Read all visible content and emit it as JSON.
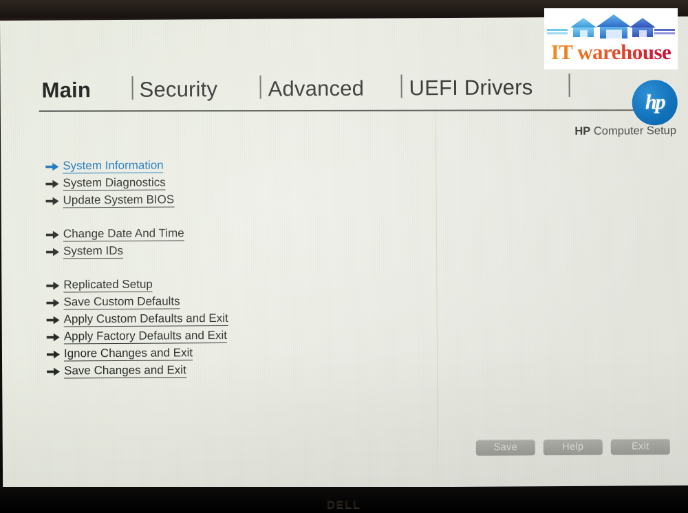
{
  "device": {
    "monitor_brand": "DELL"
  },
  "watermark": {
    "text": "IT warehouse",
    "house_count": 3,
    "colors": {
      "house_light": "#5bb8e8",
      "house_mid": "#3f8fd8",
      "house_dark": "#3b66c4",
      "text_gradient_start": "#f2921f",
      "text_gradient_end": "#c00c3a"
    }
  },
  "app": {
    "brand": "HP",
    "caption_bold": "HP",
    "caption_rest": " Computer Setup",
    "logo_text": "hp",
    "accent_color": "#1472b8",
    "logo_color": "#0f73bd"
  },
  "tabs": [
    {
      "label": "Main",
      "active": true
    },
    {
      "label": "Security",
      "active": false
    },
    {
      "label": "Advanced",
      "active": false
    },
    {
      "label": "UEFI Drivers",
      "active": false
    }
  ],
  "menu": {
    "groups": [
      {
        "items": [
          {
            "label": "System Information",
            "selected": true
          },
          {
            "label": "System Diagnostics",
            "selected": false
          },
          {
            "label": "Update System BIOS",
            "selected": false
          }
        ]
      },
      {
        "items": [
          {
            "label": "Change Date And Time",
            "selected": false
          },
          {
            "label": "System IDs",
            "selected": false
          }
        ]
      },
      {
        "items": [
          {
            "label": "Replicated Setup",
            "selected": false
          },
          {
            "label": "Save Custom Defaults",
            "selected": false
          },
          {
            "label": "Apply Custom Defaults and Exit",
            "selected": false
          },
          {
            "label": "Apply Factory Defaults and Exit",
            "selected": false
          },
          {
            "label": "Ignore Changes and Exit",
            "selected": false
          },
          {
            "label": "Save Changes and Exit",
            "selected": false
          }
        ]
      }
    ]
  },
  "buttons": [
    {
      "label": "Save"
    },
    {
      "label": "Help"
    },
    {
      "label": "Exit"
    }
  ]
}
